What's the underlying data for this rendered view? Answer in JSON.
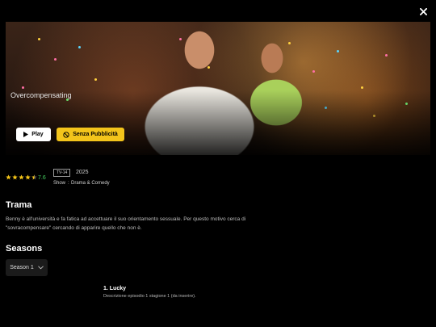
{
  "header": {
    "close_icon": "close-icon"
  },
  "hero": {
    "title": "Overcompensating",
    "play_label": "Play",
    "no_ads_label": "Senza Pubblicità",
    "colors": {
      "accent": "#f3c41b",
      "play_bg": "#ffffff"
    }
  },
  "meta": {
    "stars_value": 4.5,
    "stars_max": 5,
    "rating": "7.6",
    "rating_color": "#46d160",
    "tv_rating": "TV-14",
    "year": "2025",
    "type": "Show",
    "separator": ":",
    "genre": "Drama & Comedy"
  },
  "synopsis": {
    "heading": "Trama",
    "text_line1": "Benny è all'università e fa fatica ad accettuare il suo orientamento sessuale. Per questo motivo cerca di",
    "text_line2": "\"sovracompensare\" cercando di apparire quello che non è."
  },
  "seasons": {
    "heading": "Seasons",
    "selected": "Season 1",
    "episodes": [
      {
        "title": "1. Lucky",
        "description": "Descrizione episodio 1 stagione 1 (da inserire)."
      }
    ]
  }
}
